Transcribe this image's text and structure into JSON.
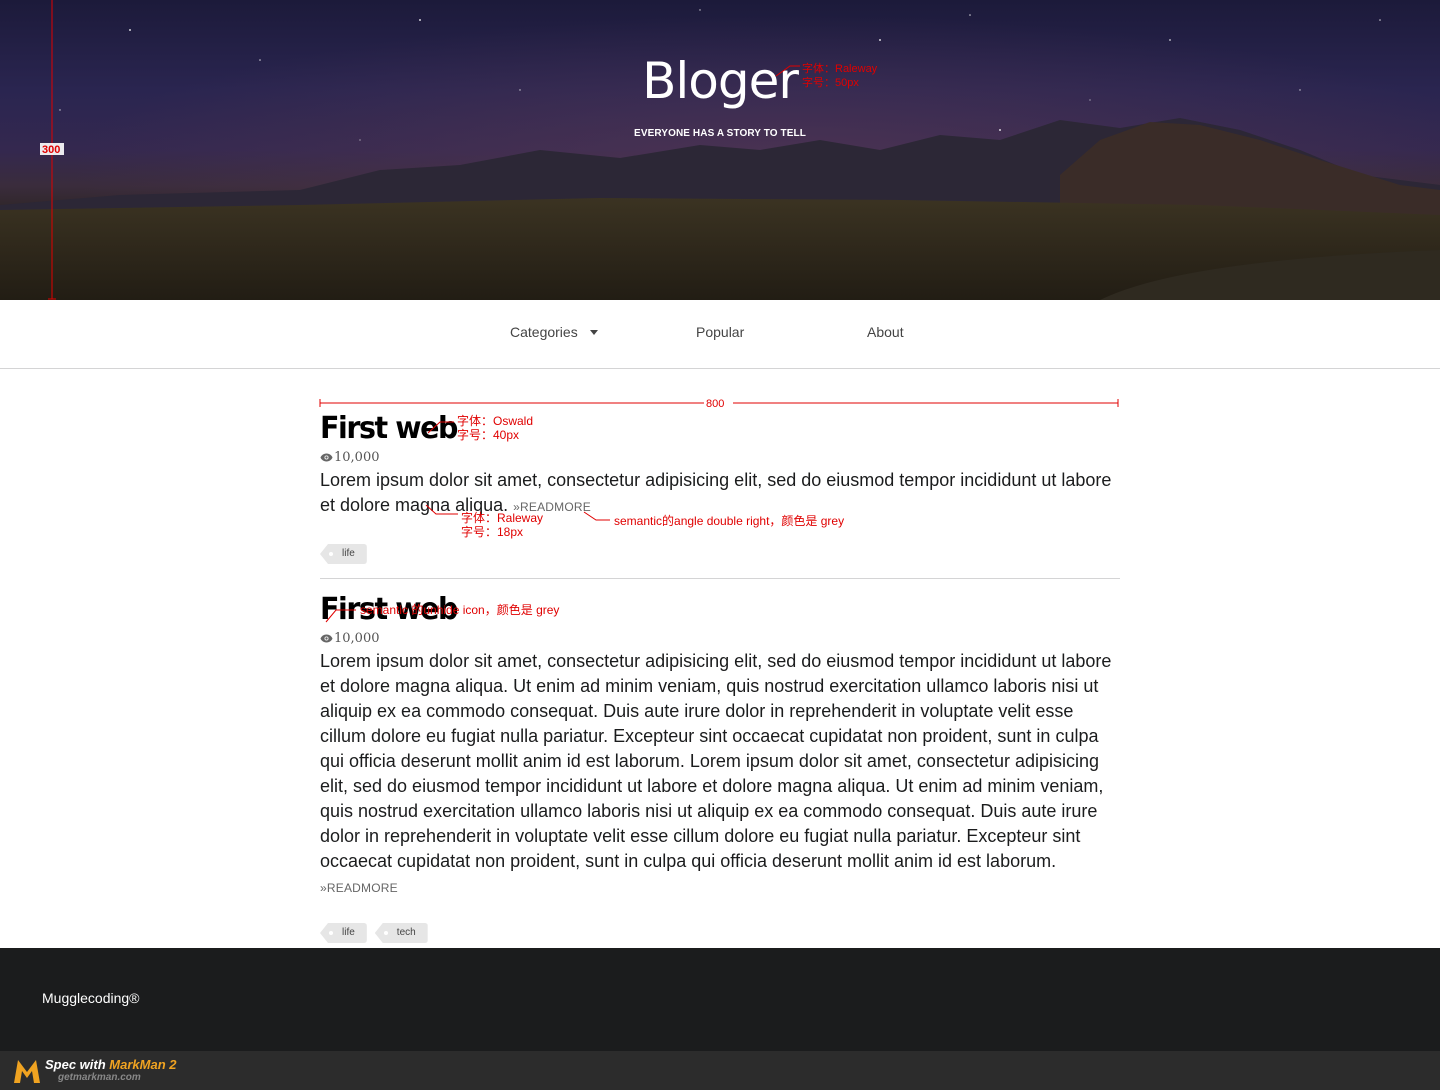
{
  "hero": {
    "title": "Bloger",
    "subtitle": "EVERYONE HAS A STORY TO TELL"
  },
  "nav": {
    "items": [
      {
        "label": "Categories",
        "has_dropdown": true
      },
      {
        "label": "Popular",
        "has_dropdown": false
      },
      {
        "label": "About",
        "has_dropdown": false
      }
    ]
  },
  "posts": [
    {
      "title": "First web",
      "views": "10,000",
      "excerpt": "Lorem ipsum dolor sit amet, consectetur adipisicing elit, sed do eiusmod tempor incididunt ut labore et dolore magna aliqua.",
      "readmore": "»READMORE",
      "tags": [
        "life"
      ]
    },
    {
      "title": "First web",
      "views": "10,000",
      "excerpt": "Lorem ipsum dolor sit amet, consectetur adipisicing elit, sed do eiusmod tempor incididunt ut labore et dolore magna aliqua. Ut enim ad minim veniam, quis nostrud exercitation ullamco laboris nisi ut aliquip ex ea commodo consequat. Duis aute irure dolor in reprehenderit in voluptate velit esse cillum dolore eu fugiat nulla pariatur. Excepteur sint occaecat cupidatat non proident, sunt in culpa qui officia deserunt mollit anim id est laborum. Lorem ipsum dolor sit amet, consectetur adipisicing elit, sed do eiusmod tempor incididunt ut labore et dolore magna aliqua. Ut enim ad minim veniam, quis nostrud exercitation ullamco laboris nisi ut aliquip ex ea commodo consequat. Duis aute irure dolor in reprehenderit in voluptate velit esse cillum dolore eu fugiat nulla pariatur. Excepteur sint occaecat cupidatat non proident, sunt in culpa qui officia deserunt mollit anim id est laborum.",
      "readmore": "»READMORE",
      "tags": [
        "life",
        "tech"
      ]
    }
  ],
  "footer": {
    "brand": "Mugglecoding®"
  },
  "markman": {
    "prefix": "Spec with ",
    "name": "MarkMan 2",
    "url": "getmarkman.com"
  },
  "annotations": {
    "hero_height": "300",
    "title_font": "字体：Raleway",
    "title_size": "字号：50px",
    "content_width": "800",
    "post_title_font": "字体：Oswald",
    "post_title_size": "字号：40px",
    "body_font": "字体：Raleway",
    "body_size": "字号：18px",
    "readmore_note": "semantic的angle double right，颜色是 grey",
    "eye_note": "semantic 的unhide icon，颜色是 grey"
  },
  "colors": {
    "hero_sky": "#1c1a3a",
    "footer_bg": "#1b1c1d",
    "annotation_red": "#e00000",
    "tag_bg": "#e6e6e6",
    "markman_accent": "#f0a321"
  }
}
